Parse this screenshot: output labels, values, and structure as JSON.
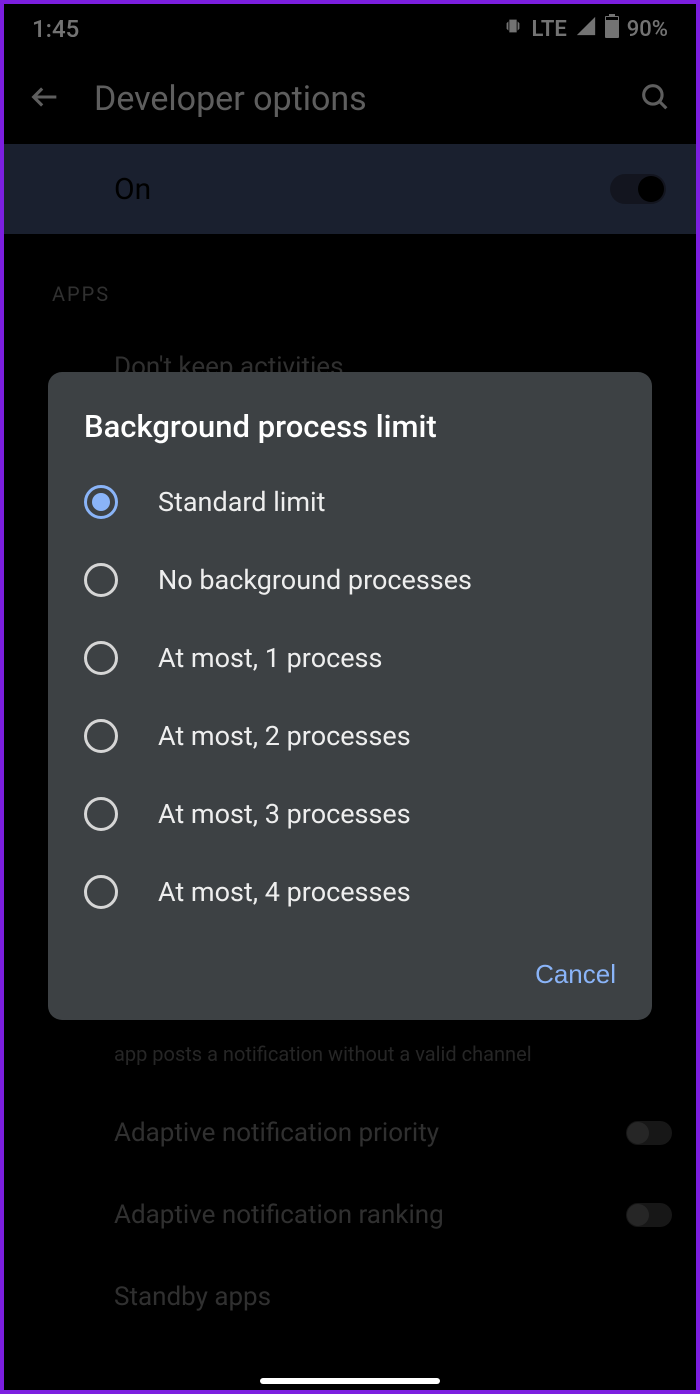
{
  "status": {
    "time": "1:45",
    "network": "LTE",
    "battery": "90%"
  },
  "header": {
    "title": "Developer options"
  },
  "master_toggle": {
    "label": "On"
  },
  "section": {
    "apps_label": "APPS"
  },
  "settings": {
    "dont_keep": "Don't keep activities",
    "notif_sub": "app posts a notification without a valid channel",
    "adaptive_priority": "Adaptive notification priority",
    "adaptive_ranking": "Adaptive notification ranking",
    "standby": "Standby apps"
  },
  "dialog": {
    "title": "Background process limit",
    "options": [
      "Standard limit",
      "No background processes",
      "At most, 1 process",
      "At most, 2 processes",
      "At most, 3 processes",
      "At most, 4 processes"
    ],
    "selected_index": 0,
    "cancel": "Cancel"
  }
}
